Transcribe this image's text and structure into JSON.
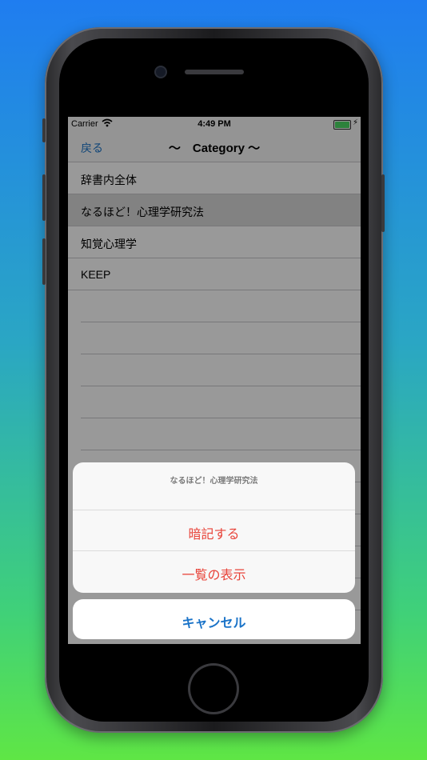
{
  "status": {
    "carrier": "Carrier",
    "time": "4:49 PM"
  },
  "nav": {
    "back_label": "戻る",
    "title": "〜　Category 〜"
  },
  "list": {
    "items": [
      {
        "label": "辞書内全体"
      },
      {
        "label": "なるほど！心理学研究法"
      },
      {
        "label": "知覚心理学"
      },
      {
        "label": "KEEP"
      }
    ]
  },
  "action_sheet": {
    "title": "なるほど！心理学研究法",
    "actions": [
      {
        "label": "暗記する"
      },
      {
        "label": "一覧の表示"
      }
    ],
    "cancel_label": "キャンセル"
  },
  "colors": {
    "accent": "#1a73c8",
    "destructive": "#e8443a",
    "battery": "#4cd964"
  }
}
